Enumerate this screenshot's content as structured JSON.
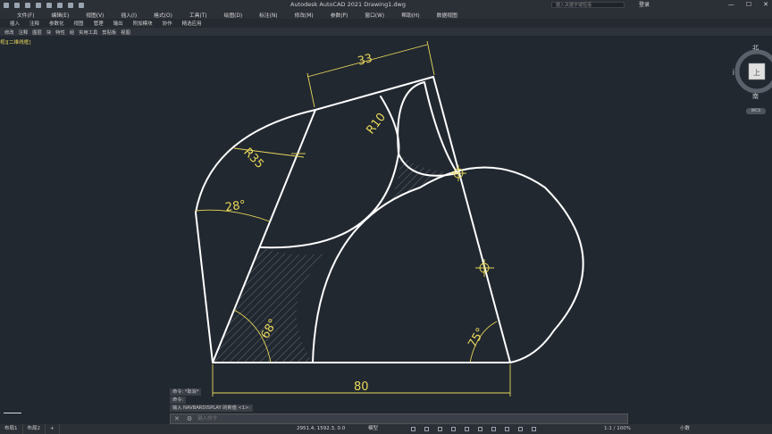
{
  "window": {
    "title": "Autodesk AutoCAD 2021    Drawing1.dwg",
    "search_placeholder": "键入关键字或短语",
    "login": "登录",
    "buttons": [
      "—",
      "☐",
      "✕"
    ]
  },
  "menubar": [
    "文件(F)",
    "编辑(E)",
    "视图(V)",
    "插入(I)",
    "格式(O)",
    "工具(T)",
    "绘图(D)",
    "标注(N)",
    "修改(M)",
    "参数(P)",
    "窗口(W)",
    "帮助(H)",
    "数据视图"
  ],
  "ribbon_tabs": [
    "插入",
    "注释",
    "参数化",
    "视图",
    "管理",
    "输出",
    "附加模块",
    "协作",
    "精选应用"
  ],
  "ribbon_panels": [
    "修改",
    "注释",
    "图层",
    "块",
    "特性",
    "组",
    "实用工具",
    "剪贴板",
    "视图"
  ],
  "viewport_label": "视][二维线框]",
  "viewcube": {
    "north": "北",
    "west": "西",
    "top": "上",
    "south": "南",
    "wcs": "WCS"
  },
  "dimensions": {
    "top": "33",
    "bottom": "80",
    "r10": "R10",
    "r35": "R35",
    "a28": "28°",
    "a68": "68°",
    "a75": "75°"
  },
  "command": {
    "history": [
      "命令: *取消*",
      "命令:",
      "输入 NAVBARDISPLAY 的新值 <1>:"
    ],
    "placeholder": "键入命令"
  },
  "status": {
    "tabs": [
      "布局1",
      "布局2",
      "+"
    ],
    "coords": "2951.4, 1592.3, 0.0",
    "model": "模型",
    "scale": "1:1 / 100%",
    "units": "小数"
  },
  "colors": {
    "background": "#212830",
    "geometry": "#ffffff",
    "dimension": "#e8d75a",
    "hatch": "#7d848c"
  }
}
